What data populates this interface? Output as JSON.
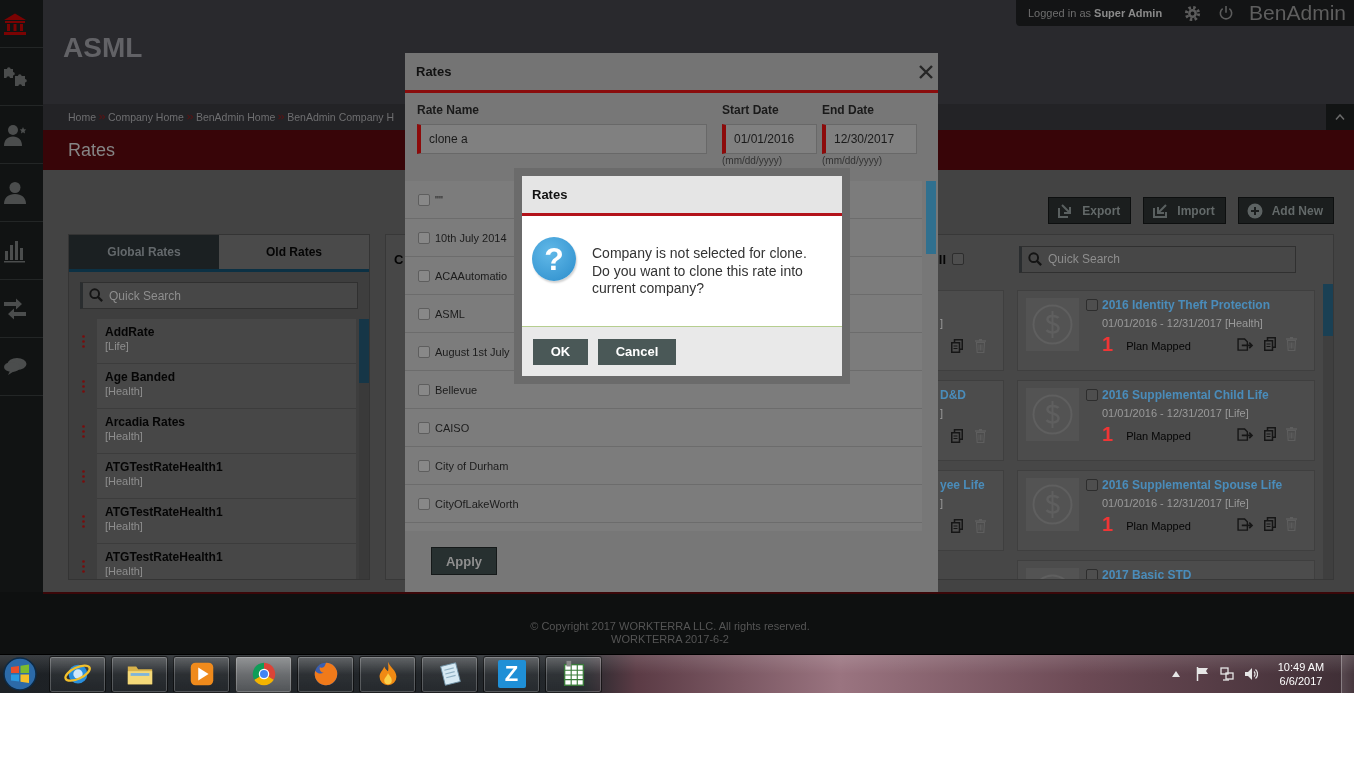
{
  "sidebar": {
    "items": [
      {
        "selected": true
      },
      {
        "selected": false
      },
      {
        "selected": false
      },
      {
        "selected": false
      },
      {
        "selected": false
      },
      {
        "selected": false
      },
      {
        "selected": false
      }
    ]
  },
  "header": {
    "company": "ASML",
    "login_status": "Logged in as **Super Admin**",
    "app_name": "BenAdmin"
  },
  "breadcrumbs": [
    "Home",
    "Company Home",
    "BenAdmin Home",
    "BenAdmin Company H"
  ],
  "page_title": "Rates",
  "toolbar_buttons": [
    "Export",
    "Import",
    "Add New"
  ],
  "left_panel": {
    "tabs": [
      {
        "label": "Global Rates",
        "selected": true
      },
      {
        "label": "Old Rates",
        "selected": false
      }
    ],
    "search": {
      "placeholder": "Quick Search"
    },
    "items": [
      {
        "name": "AddRate",
        "type": "[Life]"
      },
      {
        "name": "Age Banded",
        "type": "[Health]"
      },
      {
        "name": "Arcadia Rates",
        "type": "[Health]"
      },
      {
        "name": "ATGTestRateHealth1",
        "type": "[Health]"
      },
      {
        "name": "ATGTestRateHealth1",
        "type": "[Health]"
      },
      {
        "name": "ATGTestRateHealth1",
        "type": "[Health]"
      }
    ]
  },
  "rates_panel": {
    "header_text": "C",
    "select_all": {
      "label": "ll",
      "checked": false
    },
    "search": {
      "placeholder": "Quick Search"
    },
    "covered_cards": [
      {
        "subtitle": "]"
      },
      {
        "title": "D&D",
        "subtitle": "]"
      },
      {
        "title": "yee Life",
        "subtitle": "]"
      }
    ],
    "cards": [
      {
        "title": "2016 Identity Theft Protection",
        "checked": false,
        "dates": "01/01/2016 - 12/31/2017 [Health]",
        "count": "1",
        "count_label": "Plan Mapped"
      },
      {
        "title": "2016 Supplemental Child Life",
        "checked": false,
        "dates": "01/01/2016 - 12/31/2017 [Life]",
        "count": "1",
        "count_label": "Plan Mapped"
      },
      {
        "title": "2016 Supplemental Spouse Life",
        "checked": false,
        "dates": "01/01/2016 - 12/31/2017 [Life]",
        "count": "1",
        "count_label": "Plan Mapped"
      },
      {
        "title": "2017 Basic STD",
        "checked": false
      }
    ]
  },
  "footer": {
    "copyright": "© Copyright 2017 WORKTERRA LLC. All rights reserved.",
    "version": "WORKTERRA 2017-6-2"
  },
  "rates_modal": {
    "title": "Rates",
    "fields": [
      {
        "label": "Rate Name",
        "value": "clone a"
      },
      {
        "label": "Start Date",
        "value": "01/01/2016",
        "hint": "(mm/dd/yyyy)"
      },
      {
        "label": "End Date",
        "value": "12/30/2017",
        "hint": "(mm/dd/yyyy)"
      }
    ],
    "companies": [
      {
        "name": "\"\"",
        "checked": false
      },
      {
        "name": "10th July 2014",
        "checked": false
      },
      {
        "name": "ACAAutomatio",
        "checked": false
      },
      {
        "name": "ASML",
        "checked": false
      },
      {
        "name": "August 1st July",
        "checked": false
      },
      {
        "name": "Bellevue",
        "checked": false
      },
      {
        "name": "CAISO",
        "checked": false
      },
      {
        "name": "City of Durham",
        "checked": false
      },
      {
        "name": "CityOfLakeWorth",
        "checked": false
      }
    ],
    "apply_button": "Apply"
  },
  "confirm_dialog": {
    "title": "Rates",
    "icon_glyph": "?",
    "message": "Company is not selected for clone.\nDo you want to clone this rate into\ncurrent company?",
    "buttons": [
      "OK",
      "Cancel"
    ]
  },
  "taskbar": {
    "apps": [
      {
        "selected": false
      },
      {
        "selected": false
      },
      {
        "selected": false
      },
      {
        "selected": true
      },
      {
        "selected": false
      },
      {
        "selected": false
      },
      {
        "selected": false
      },
      {
        "selected": false,
        "glyph": "Z"
      },
      {
        "selected": false
      }
    ],
    "clock": {
      "time": "10:49 AM",
      "date": "6/6/2017"
    }
  }
}
